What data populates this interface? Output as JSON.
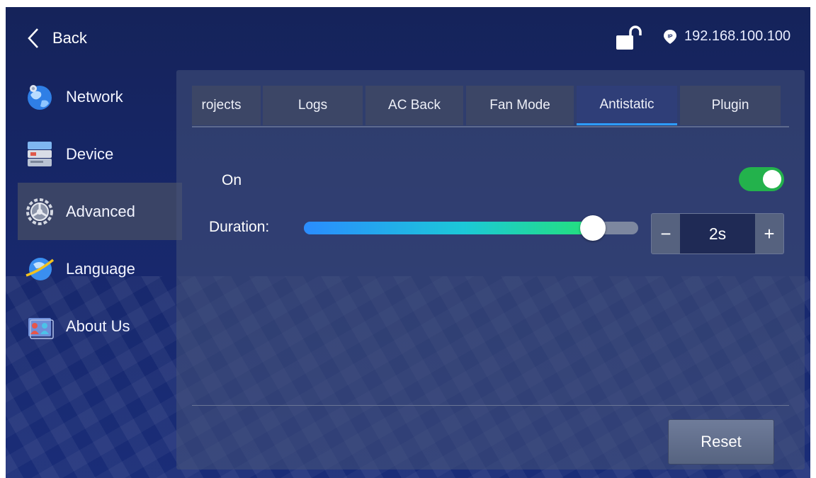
{
  "header": {
    "back_label": "Back",
    "ip_address": "192.168.100.100",
    "lock_icon": "unlocked-lock-icon",
    "ip_icon": "location-pin-ip-icon"
  },
  "sidebar": {
    "items": [
      {
        "label": "Network",
        "icon": "network-globe-icon",
        "active": false
      },
      {
        "label": "Device",
        "icon": "device-server-icon",
        "active": false
      },
      {
        "label": "Advanced",
        "icon": "gear-icon",
        "active": true
      },
      {
        "label": "Language",
        "icon": "language-globe-icon",
        "active": false
      },
      {
        "label": "About Us",
        "icon": "people-icon",
        "active": false
      }
    ]
  },
  "tabs": [
    {
      "label": "rojects",
      "active": false
    },
    {
      "label": "Logs",
      "active": false
    },
    {
      "label": "AC Back",
      "active": false
    },
    {
      "label": "Fan Mode",
      "active": false
    },
    {
      "label": "Antistatic",
      "active": true
    },
    {
      "label": "Plugin",
      "active": false
    }
  ],
  "antistatic": {
    "on_label": "On",
    "toggle_on": true,
    "duration_label": "Duration:",
    "duration_value": "2s",
    "slider_fraction": 0.865,
    "decrement_label": "−",
    "increment_label": "+"
  },
  "footer": {
    "reset_label": "Reset"
  },
  "colors": {
    "background": "#17276a",
    "accent": "#2d9cff",
    "toggle_on": "#23b24c"
  }
}
